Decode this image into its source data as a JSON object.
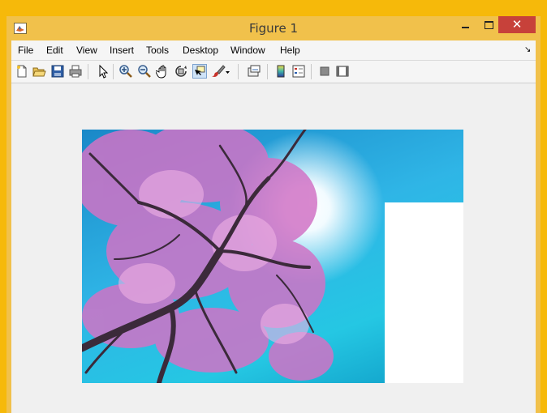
{
  "window": {
    "title": "Figure 1"
  },
  "title_buttons": {
    "close": "✕"
  },
  "menu": {
    "items": [
      {
        "label": "File"
      },
      {
        "label": "Edit"
      },
      {
        "label": "View"
      },
      {
        "label": "Insert"
      },
      {
        "label": "Tools"
      },
      {
        "label": "Desktop"
      },
      {
        "label": "Window"
      },
      {
        "label": "Help"
      }
    ],
    "dock_arrow": "↘"
  },
  "toolbar": {
    "icons": [
      "new-figure-icon",
      "open-file-icon",
      "save-figure-icon",
      "print-figure-icon",
      "edit-plot-icon",
      "zoom-in-icon",
      "zoom-out-icon",
      "pan-icon",
      "rotate-3d-icon",
      "data-cursor-icon",
      "brush-icon",
      "brush-dropdown-icon",
      "link-plot-icon",
      "insert-colorbar-icon",
      "insert-legend-icon",
      "hide-plot-tools-icon",
      "show-plot-tools-icon"
    ],
    "active": "data-cursor-icon"
  },
  "figure": {
    "image": "photo-pink-blossom-tree-against-blue-sky",
    "overlay": "white-rectangle"
  },
  "colors": {
    "frame": "#f1c14b",
    "close_button": "#c7413a",
    "background": "#f0f0f0"
  }
}
